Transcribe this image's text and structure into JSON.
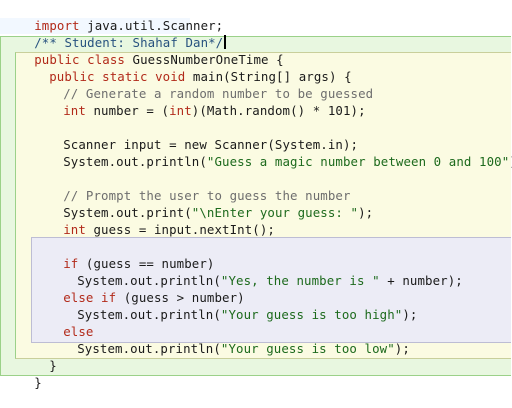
{
  "colors": {
    "class_block": "#e8f7e0",
    "method_block": "#fbfbe2",
    "if_block": "#ececf6",
    "block_border": "#9bd189",
    "if_border": "#bdbdd4",
    "keyword": "#b22a1a",
    "comment": "#6e6e6e",
    "string": "#1d6a1d"
  },
  "code": {
    "import": {
      "kw": "import",
      "rest": " java.util.Scanner;"
    },
    "student_comment": "/** Student: Shahaf Dan*/",
    "class_decl": {
      "kw": "public class",
      "rest": " GuessNumberOneTime {"
    },
    "main_decl": {
      "kw": "public static void",
      "rest": " main(String[] args) {"
    },
    "comment_random": "// Generate a random number to be guessed",
    "number_line": {
      "kw": "int",
      "rest": " number = (",
      "kw2": "int",
      "rest2": ")(Math.random() * 101);"
    },
    "scanner_line": "Scanner input = new Scanner(System.in);",
    "println_intro": {
      "pre": "System.out.println(",
      "str": "\"Guess a magic number between 0 and 100\"",
      "post": ");"
    },
    "comment_prompt": "// Prompt the user to guess the number",
    "print_enter": {
      "pre": "System.out.print(",
      "str": "\"\\nEnter your guess: \"",
      "post": ");"
    },
    "guess_line": {
      "kw": "int",
      "rest": " guess = input.nextInt();"
    },
    "if_line": {
      "kw": "if",
      "rest": " (guess == number)"
    },
    "println_yes": {
      "pre": "System.out.println(",
      "str": "\"Yes, the number is \"",
      "post": " + number);"
    },
    "else_if_line": {
      "kw": "else if",
      "rest": " (guess > number)"
    },
    "println_high": {
      "pre": "System.out.println(",
      "str": "\"Your guess is too high\"",
      "post": ");"
    },
    "else_line": {
      "kw": "else"
    },
    "println_low": {
      "pre": "System.out.println(",
      "str": "\"Your guess is too low\"",
      "post": ");"
    },
    "close_method": "}",
    "close_class": "}"
  }
}
